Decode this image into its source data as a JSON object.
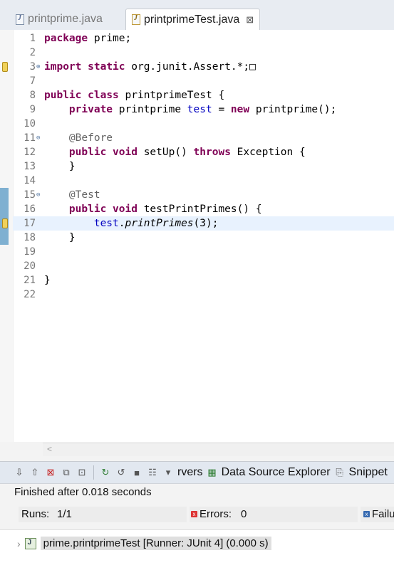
{
  "tabs": [
    {
      "label": "printprime.java",
      "active": false
    },
    {
      "label": "printprimeTest.java",
      "active": true,
      "close": "⊠"
    }
  ],
  "editor": {
    "lines": [
      {
        "n": "1",
        "html": "<span class=\"kw\">package</span> prime;"
      },
      {
        "n": "2",
        "html": ""
      },
      {
        "n": "3",
        "html": "<span class=\"kw\">import</span> <span class=\"kw\">static</span> org.junit.Assert.*;&#9633;",
        "fold": "⊕",
        "marker": true
      },
      {
        "n": "7",
        "html": ""
      },
      {
        "n": "8",
        "html": "<span class=\"kw\">public</span> <span class=\"kw\">class</span> printprimeTest {"
      },
      {
        "n": "9",
        "html": "    <span class=\"kw\">private</span> printprime <span class=\"fld\">test</span> = <span class=\"kw\">new</span> printprime();"
      },
      {
        "n": "10",
        "html": ""
      },
      {
        "n": "11",
        "html": "    <span class=\"ann\">@Before</span>",
        "fold": "⊖"
      },
      {
        "n": "12",
        "html": "    <span class=\"kw\">public</span> <span class=\"kw\">void</span> setUp() <span class=\"kw\">throws</span> Exception {"
      },
      {
        "n": "13",
        "html": "    }"
      },
      {
        "n": "14",
        "html": ""
      },
      {
        "n": "15",
        "html": "    <span class=\"ann\">@Test</span>",
        "fold": "⊖"
      },
      {
        "n": "16",
        "html": "    <span class=\"kw\">public</span> <span class=\"kw\">void</span> testPrintPrimes() {"
      },
      {
        "n": "17",
        "html": "        <span class=\"fld\">test</span>.<span class=\"ital\">printPrimes</span>(3);",
        "highlight": true,
        "marker": true
      },
      {
        "n": "18",
        "html": "    }"
      },
      {
        "n": "19",
        "html": ""
      },
      {
        "n": "20",
        "html": ""
      },
      {
        "n": "21",
        "html": "}"
      },
      {
        "n": "22",
        "html": ""
      }
    ]
  },
  "hscroll": {
    "left_arrow": "<"
  },
  "viewbar": {
    "tabs_label": "rvers",
    "data_source": "Data Source Explorer",
    "snippets": "Snippet"
  },
  "junit": {
    "status": "Finished after 0.018 seconds",
    "runs_label": "Runs:",
    "runs_value": "1/1",
    "errors_label": "Errors:",
    "errors_value": "0",
    "failures_label": "Failu",
    "tree_item": "prime.printprimeTest [Runner: JUnit 4] (0.000 s)"
  }
}
